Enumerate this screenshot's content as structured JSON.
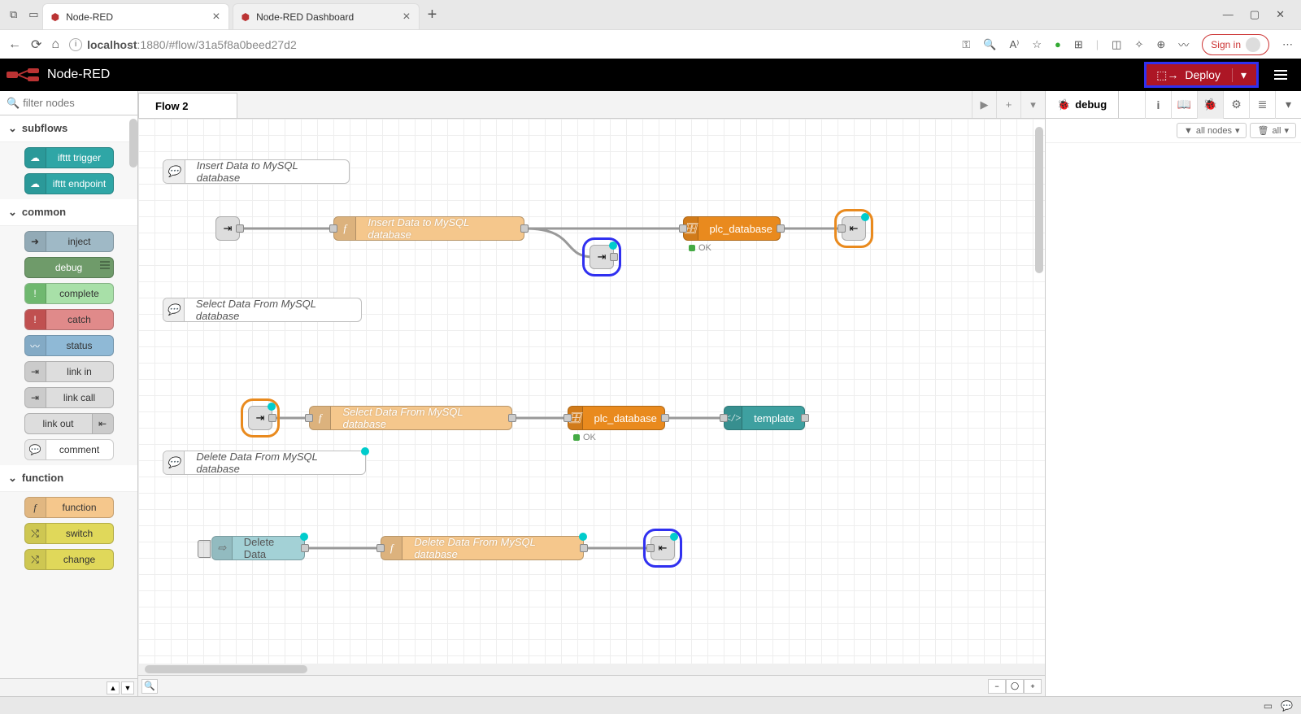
{
  "browser": {
    "tabs": [
      {
        "title": "Node-RED",
        "active": true
      },
      {
        "title": "Node-RED Dashboard",
        "active": false
      }
    ],
    "url_prefix": "localhost",
    "url_rest": ":1880/#flow/31a5f8a0beed27d2",
    "signin": "Sign in"
  },
  "header": {
    "brand": "Node-RED",
    "deploy": "Deploy"
  },
  "palette": {
    "filter_placeholder": "filter nodes",
    "categories": {
      "subflows": "subflows",
      "common": "common",
      "function": "function"
    },
    "subflows": [
      {
        "label": "ifttt trigger",
        "color": "#2fa6a6"
      },
      {
        "label": "ifttt endpoint",
        "color": "#2fa6a6"
      }
    ],
    "common": [
      {
        "label": "inject",
        "color": "#9fb9c6"
      },
      {
        "label": "debug",
        "color": "#6f9b6a",
        "bars": true
      },
      {
        "label": "complete",
        "color": "#a8e0a8"
      },
      {
        "label": "catch",
        "color": "#e08a8a"
      },
      {
        "label": "status",
        "color": "#8fb9d6"
      },
      {
        "label": "link in",
        "color": "#ddd"
      },
      {
        "label": "link call",
        "color": "#ddd"
      },
      {
        "label": "link out",
        "color": "#ddd",
        "icon_right": true
      },
      {
        "label": "comment",
        "color": "#eee"
      }
    ],
    "function": [
      {
        "label": "function",
        "color": "#f5c78c"
      },
      {
        "label": "switch",
        "color": "#e0d85a"
      },
      {
        "label": "change",
        "color": "#e0d85a"
      }
    ]
  },
  "workspace": {
    "tab": "Flow 2",
    "comments": {
      "c1": "Insert Data to MySQL database",
      "c2": "Select Data From MySQL database",
      "c3": "Delete Data From MySQL database"
    },
    "nodes": {
      "f1": "Insert Data to MySQL database",
      "f2": "Select Data From MySQL database",
      "f3": "Delete Data From MySQL database",
      "db1": "plc_database",
      "db2": "plc_database",
      "tmpl": "template",
      "inj": "Delete Data",
      "ok": "OK"
    }
  },
  "sidebar": {
    "tab": "debug",
    "filter_all_nodes": "all nodes",
    "filter_all": "all"
  }
}
